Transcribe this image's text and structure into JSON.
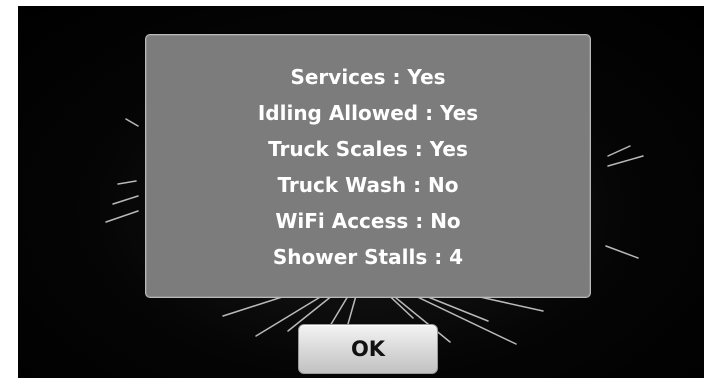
{
  "dialog": {
    "lines": [
      "Services : Yes",
      "Idling Allowed : Yes",
      "Truck Scales : Yes",
      "Truck Wash : No",
      "WiFi Access : No",
      "Shower Stalls : 4"
    ]
  },
  "buttons": {
    "ok_label": "OK"
  },
  "colors": {
    "background": "#000000",
    "dialog": "#7c7c7c",
    "text": "#ffffff",
    "button": "#dcdcdc"
  }
}
